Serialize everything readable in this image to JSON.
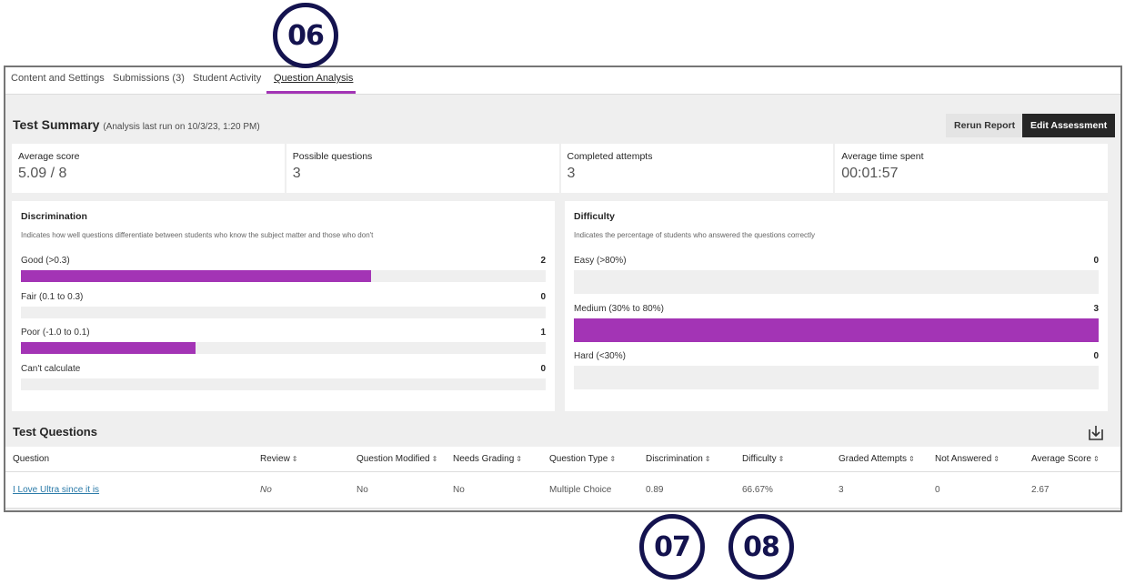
{
  "tabs": [
    {
      "label": "Content and Settings",
      "active": false
    },
    {
      "label": "Submissions (3)",
      "active": false
    },
    {
      "label": "Student Activity",
      "active": false
    },
    {
      "label": "Question Analysis",
      "active": true
    }
  ],
  "summary": {
    "title": "Test Summary",
    "subtitle": "(Analysis last run on 10/3/23, 1:20 PM)",
    "rerun_label": "Rerun Report",
    "edit_label": "Edit Assessment",
    "stats": [
      {
        "label": "Average score",
        "value": "5.09 / 8"
      },
      {
        "label": "Possible questions",
        "value": "3"
      },
      {
        "label": "Completed attempts",
        "value": "3"
      },
      {
        "label": "Average time spent",
        "value": "00:01:57"
      }
    ]
  },
  "accent_color": "#a334b5",
  "chart_data": [
    {
      "type": "bar",
      "orientation": "horizontal",
      "title": "Discrimination",
      "subtitle": "Indicates how well questions differentiate between students who know the subject matter and those who don't",
      "max": 3,
      "categories": [
        "Good (>0.3)",
        "Fair (0.1 to 0.3)",
        "Poor (-1.0 to 0.1)",
        "Can't calculate"
      ],
      "values": [
        2,
        0,
        1,
        0
      ]
    },
    {
      "type": "bar",
      "orientation": "horizontal",
      "title": "Difficulty",
      "subtitle": "Indicates the percentage of students who answered the questions correctly",
      "max": 3,
      "categories": [
        "Easy (>80%)",
        "Medium (30% to 80%)",
        "Hard (<30%)"
      ],
      "values": [
        0,
        3,
        0
      ]
    }
  ],
  "questions": {
    "title": "Test Questions",
    "download_icon": "download-icon",
    "sort_glyph": "⇕",
    "columns": [
      "Question",
      "Review",
      "Question Modified",
      "Needs Grading",
      "Question Type",
      "Discrimination",
      "Difficulty",
      "Graded Attempts",
      "Not Answered",
      "Average Score"
    ],
    "rows": [
      [
        "I Love Ultra since it is",
        "No",
        "No",
        "No",
        "Multiple Choice",
        "0.89",
        "66.67%",
        "3",
        "0",
        "2.67"
      ]
    ]
  },
  "callouts": [
    "06",
    "07",
    "08"
  ]
}
